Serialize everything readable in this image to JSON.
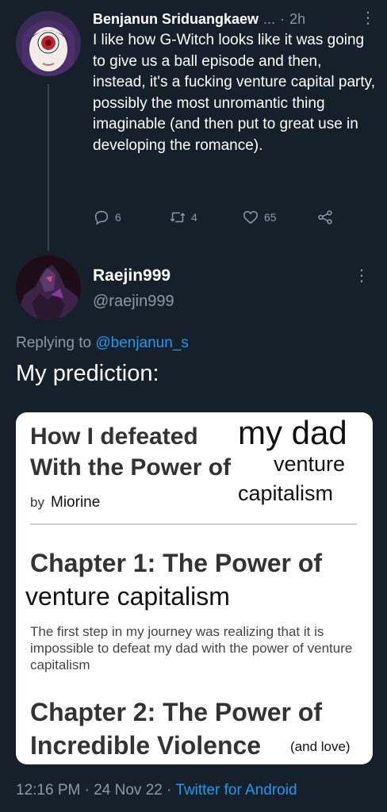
{
  "parent_tweet": {
    "author_name": "Benjanun Sriduangkaew",
    "ellipsis": "...",
    "separator": "·",
    "time": "2h",
    "text": "I like how G-Witch looks like it was going to give us a ball episode and then, instead, it's a fucking venture capital party, possibly the most unromantic thing imaginable (and then put to great use in developing the romance).",
    "actions": {
      "reply_count": "6",
      "retweet_count": "4",
      "like_count": "65"
    }
  },
  "reply_tweet": {
    "author_name": "Raejin999",
    "handle": "@raejin999",
    "replying_prefix": "Replying to",
    "replying_to": "@benjanun_s",
    "text": "My prediction:",
    "image": {
      "title_line1": "How I defeated",
      "hand_line1": "my dad",
      "title_line2": "With the Power of",
      "hand_line2": "venture",
      "hand_line3": "capitalism",
      "by_label": "by",
      "by_name": "Miorine",
      "chapter1": "Chapter 1: The Power of",
      "chapter1_sub": "venture capitalism",
      "body": "The first step in my journey was realizing that it is impossible to defeat my dad  with the power of venture capitalism",
      "chapter2_line1": "Chapter 2: The Power of",
      "chapter2_line2": "Incredible Violence",
      "chapter2_note": "(and love)"
    },
    "footer": {
      "time": "12:16 PM",
      "sep1": "·",
      "date": "24 Nov 22",
      "sep2": "·",
      "source": "Twitter for Android"
    }
  },
  "colors": {
    "background": "#15202b",
    "secondary_text": "#8b98a5",
    "link": "#1d9bf0"
  }
}
